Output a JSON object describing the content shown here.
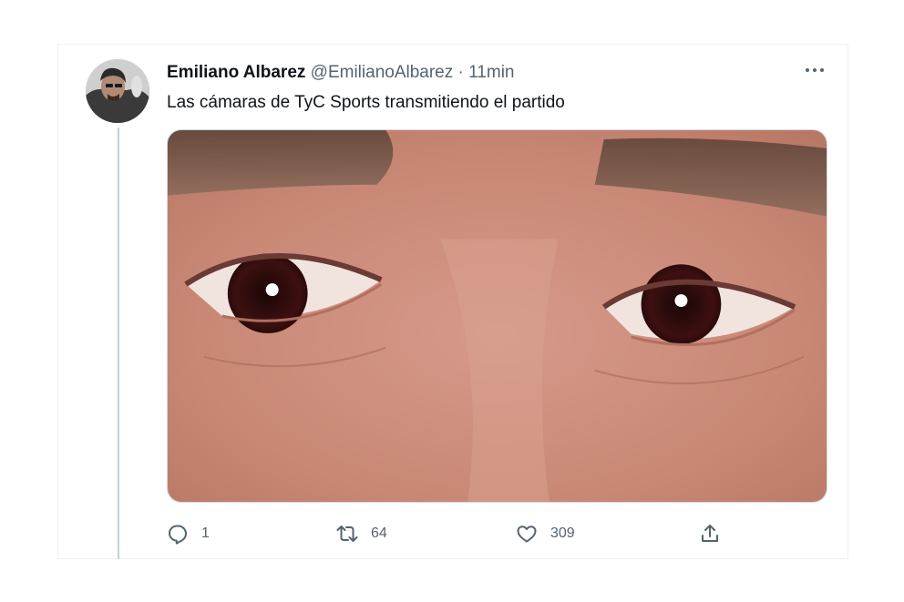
{
  "tweet": {
    "author_name": "Emiliano Albarez",
    "author_handle": "@EmilianoAlbarez",
    "separator": "·",
    "time": "11min",
    "text": "Las cámaras de TyC Sports transmitiendo el partido"
  },
  "actions": {
    "reply_count": "1",
    "retweet_count": "64",
    "like_count": "309"
  },
  "icons": {
    "avatar": "avatar",
    "more": "more-options-icon",
    "reply": "reply-icon",
    "retweet": "retweet-icon",
    "like": "heart-icon",
    "share": "share-icon"
  },
  "colors": {
    "secondary_text": "#536471",
    "primary_text": "#0f1419",
    "thread_line": "#c4cfd6"
  }
}
